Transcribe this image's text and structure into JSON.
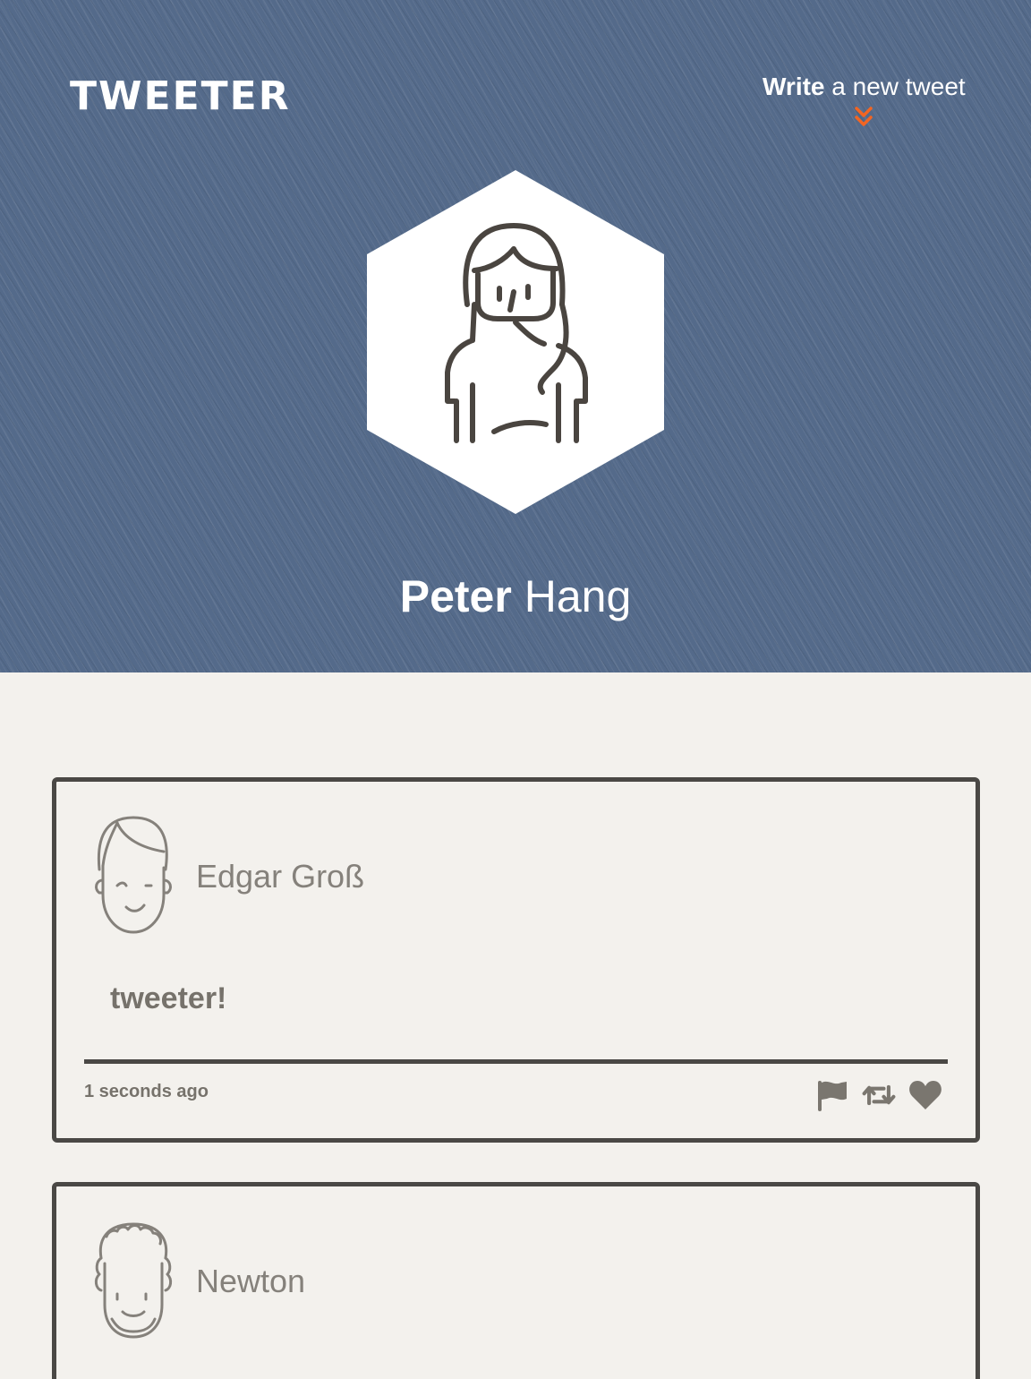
{
  "header": {
    "logo": "TWEETER",
    "compose": {
      "strong": "Write",
      "light": "a new tweet"
    },
    "profile": {
      "first_name": "Peter",
      "last_name": "Hang"
    }
  },
  "tweets": [
    {
      "author": "Edgar Groß",
      "body": "tweeter!",
      "time": "1 seconds ago",
      "avatar_icon": "boy-avatar-icon",
      "actions": [
        "flag-icon",
        "retweet-icon",
        "heart-icon"
      ]
    },
    {
      "author": "Newton",
      "avatar_icon": "curly-hair-avatar-icon"
    }
  ],
  "colors": {
    "header_bg": "#546a8a",
    "page_bg": "#f3f1ed",
    "accent": "#f26522",
    "border": "#4a4845",
    "muted_text": "#85817b"
  }
}
